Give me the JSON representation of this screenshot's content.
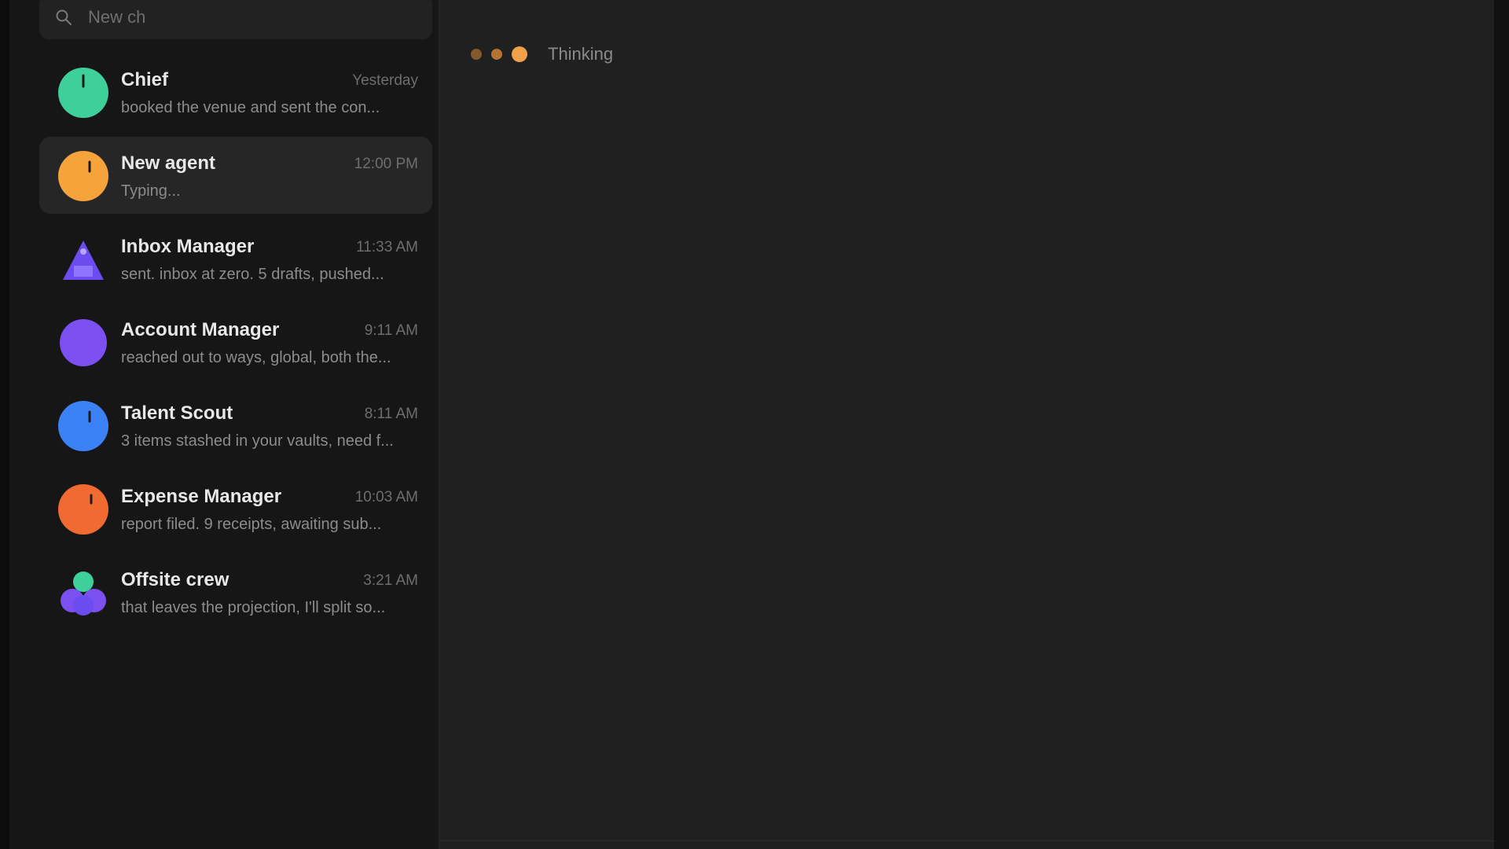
{
  "search": {
    "placeholder": "New ch"
  },
  "chats": [
    {
      "name": "Chief",
      "time": "Yesterday",
      "preview": "booked the venue and sent the con...",
      "avatar_color": "#3ecf9a",
      "icon": "chief-avatar-icon"
    },
    {
      "name": "New agent",
      "time": "12:00 PM",
      "preview": "Typing...",
      "avatar_color": "#f5a33a",
      "icon": "new-agent-avatar-icon",
      "active": true
    },
    {
      "name": "Inbox Manager",
      "time": "11:33 AM",
      "preview": "sent. inbox at zero. 5 drafts, pushed...",
      "avatar_color": "#6a4cf0",
      "icon": "inbox-manager-avatar-icon"
    },
    {
      "name": "Account Manager",
      "time": "9:11 AM",
      "preview": "reached out to ways, global, both the...",
      "avatar_color": "#7b4ff0",
      "icon": "account-manager-avatar-icon"
    },
    {
      "name": "Talent Scout",
      "time": "8:11 AM",
      "preview": "3 items stashed in your vaults, need f...",
      "avatar_color": "#3b82f6",
      "icon": "talent-scout-avatar-icon"
    },
    {
      "name": "Expense Manager",
      "time": "10:03 AM",
      "preview": "report filed. 9 receipts, awaiting sub...",
      "avatar_color": "#f06a32",
      "icon": "expense-manager-avatar-icon"
    },
    {
      "name": "Offsite crew",
      "time": "3:21 AM",
      "preview": "that leaves the projection, I'll split so...",
      "avatar_color": "#7b4ff0",
      "icon": "group-avatar-icon"
    }
  ],
  "conversation": {
    "typing_label": "Thinking",
    "accent_color": "#f0a04a"
  }
}
